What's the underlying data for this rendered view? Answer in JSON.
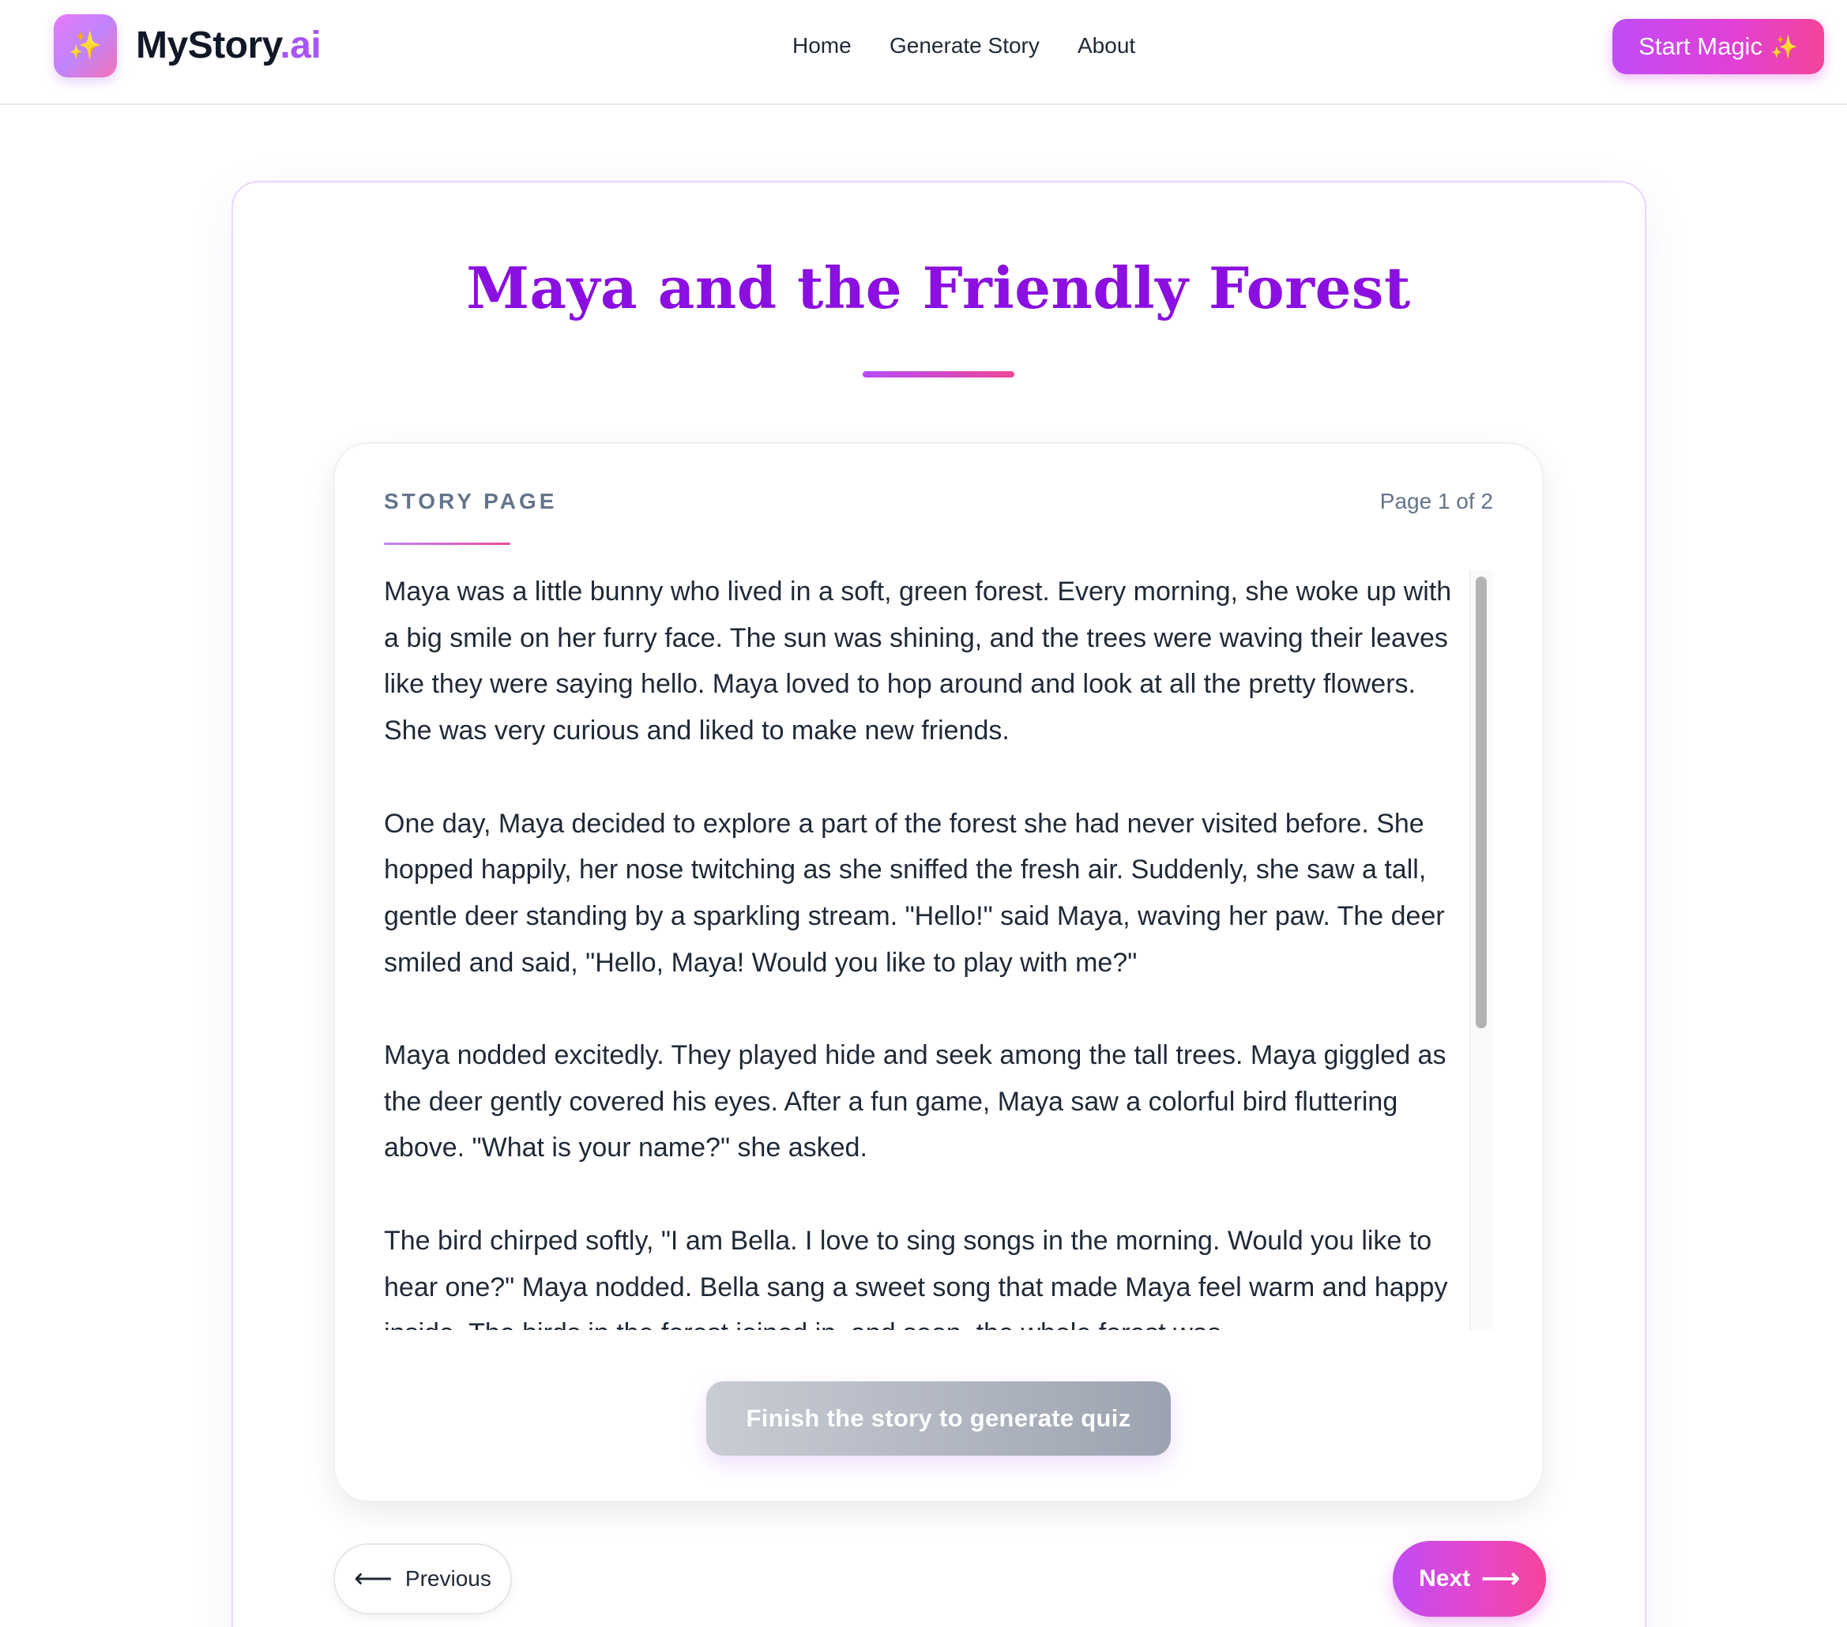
{
  "header": {
    "logo_glyph": "✨",
    "brand_main": "MyStory",
    "brand_suffix": ".ai",
    "nav": [
      {
        "label": "Home"
      },
      {
        "label": "Generate Story"
      },
      {
        "label": "About"
      }
    ],
    "cta_label": "Start Magic",
    "cta_glyph": "✨"
  },
  "story": {
    "title": "Maya and the Friendly Forest",
    "section_label": "STORY PAGE",
    "page_indicator": "Page 1 of 2",
    "paragraphs": [
      "Maya was a little bunny who lived in a soft, green forest. Every morning, she woke up with a big smile on her furry face. The sun was shining, and the trees were waving their leaves like they were saying hello. Maya loved to hop around and look at all the pretty flowers. She was very curious and liked to make new friends.",
      "One day, Maya decided to explore a part of the forest she had never visited before. She hopped happily, her nose twitching as she sniffed the fresh air. Suddenly, she saw a tall, gentle deer standing by a sparkling stream. \"Hello!\" said Maya, waving her paw. The deer smiled and said, \"Hello, Maya! Would you like to play with me?\"",
      "Maya nodded excitedly. They played hide and seek among the tall trees. Maya giggled as the deer gently covered his eyes. After a fun game, Maya saw a colorful bird fluttering above. \"What is your name?\" she asked.",
      "The bird chirped softly, \"I am Bella. I love to sing songs in the morning. Would you like to hear one?\" Maya nodded. Bella sang a sweet song that made Maya feel warm and happy inside. The birds in the forest joined in, and soon, the whole forest was"
    ],
    "quiz_button_label": "Finish the story to generate quiz"
  },
  "pagination": {
    "prev_arrow": "⟵",
    "prev_label": "Previous",
    "next_label": "Next",
    "next_arrow": "⟶"
  }
}
